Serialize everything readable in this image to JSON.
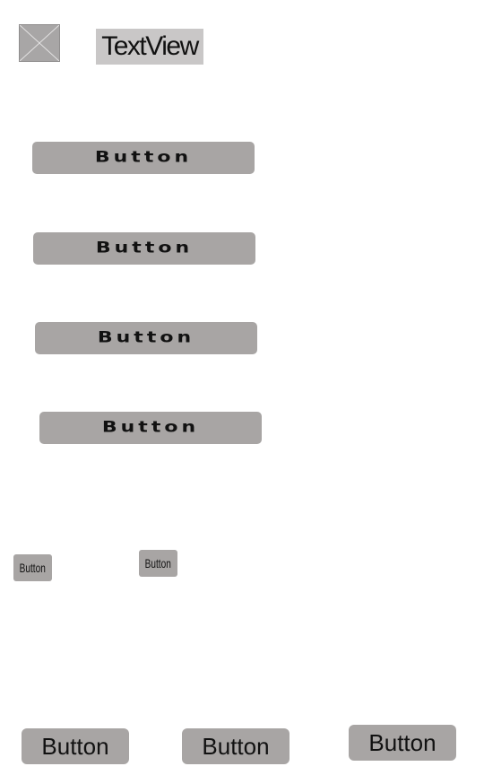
{
  "header": {
    "image_icon": "image-placeholder-icon",
    "textview_label": "TextView"
  },
  "main_buttons": [
    {
      "label": "Button"
    },
    {
      "label": "Button"
    },
    {
      "label": "Button"
    },
    {
      "label": "Button"
    }
  ],
  "small_buttons": [
    {
      "label": "Button"
    },
    {
      "label": "Button"
    }
  ],
  "bottom_buttons": [
    {
      "label": "Button"
    },
    {
      "label": "Button"
    },
    {
      "label": "Button"
    }
  ],
  "colors": {
    "background": "#ffffff",
    "button": "#a8a5a4",
    "textview": "#c9c7c7",
    "text": "#111111"
  }
}
